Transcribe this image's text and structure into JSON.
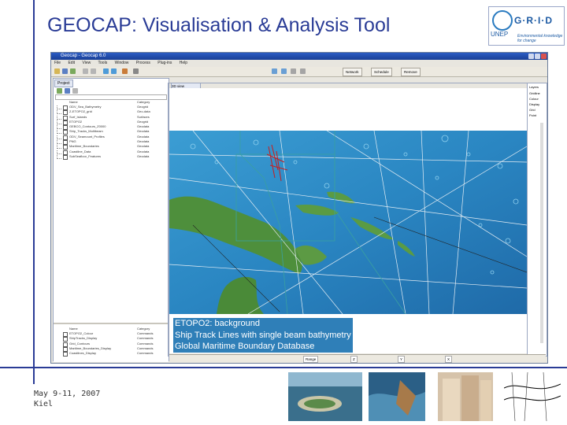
{
  "slide": {
    "title": "GEOCAP: Visualisation & Analysis Tool",
    "footer_line1": "May 9-11, 2007",
    "footer_line2": "Kiel",
    "accent_color": "#2a3c96"
  },
  "logo": {
    "grid": "G·R·I·D",
    "unep": "UNEP",
    "location": "ARENDAL",
    "tagline": "Environmental knowledge for change"
  },
  "app": {
    "window_title": "Geocap - Geocap 6.0",
    "menu": [
      "File",
      "Edit",
      "View",
      "Tools",
      "Window",
      "Process",
      "Plug-ins",
      "Help",
      "Window"
    ],
    "toolbar_buttons": [
      "Network",
      "Schedule",
      "Remove"
    ],
    "left_tab": "Project",
    "layers_header": [
      "Name",
      "Category"
    ],
    "layers": [
      {
        "name": "ODV_Sea_Bathymetry",
        "category": "Geogrid"
      },
      {
        "name": "Z-ETOPO2_grid",
        "category": "Geo-data"
      },
      {
        "name": "Surf_Islands",
        "category": "Surfaces"
      },
      {
        "name": "ETOPO2",
        "category": "Geogrid"
      },
      {
        "name": "GEBCO_Contours_Z0000",
        "category": "Geodata"
      },
      {
        "name": "Ship_Tracks_Multibeam",
        "category": "Geodata"
      },
      {
        "name": "ODV_Seamount_Profiles",
        "category": "Geodata"
      },
      {
        "name": "PNG",
        "category": "Geodata"
      },
      {
        "name": "Maritime_Boundaries",
        "category": "Geodata"
      },
      {
        "name": "Coastline_Data",
        "category": "Geodata"
      },
      {
        "name": "SubSeafloor_Features",
        "category": "Geodata"
      }
    ],
    "lower_layers_header": [
      "Name",
      "Category"
    ],
    "lower_layers": [
      {
        "name": "ETOPO2_Colour",
        "category": "Commands"
      },
      {
        "name": "ShipTracks_Display",
        "category": "Commands"
      },
      {
        "name": "Grid_Contours",
        "category": "Commands"
      },
      {
        "name": "Maritime_Boundaries_Display",
        "category": "Commands"
      },
      {
        "name": "Coastlines_Display",
        "category": "Commands"
      }
    ],
    "map_tab": "3D view",
    "status": [
      "Range",
      "Z",
      "Y",
      "X"
    ],
    "right_items": [
      "Layers",
      "Gridline",
      "Colour",
      "Display",
      "Grid",
      "Point"
    ],
    "colors": {
      "ocean": "#2f8ec8",
      "ocean_dark": "#1f5e9e",
      "land": "#4b8f3a",
      "track": "#f2f2f2",
      "boundary": "#d02020"
    }
  },
  "legend": {
    "line1": "ETOPO2: background",
    "line2": "Ship Track Lines with single beam bathymetry",
    "line3": "Global Maritime Boundary Database"
  },
  "thumbnails": [
    "coral-island-image",
    "seafloor-3d-image",
    "sediment-core-image",
    "seismic-profile-image"
  ]
}
